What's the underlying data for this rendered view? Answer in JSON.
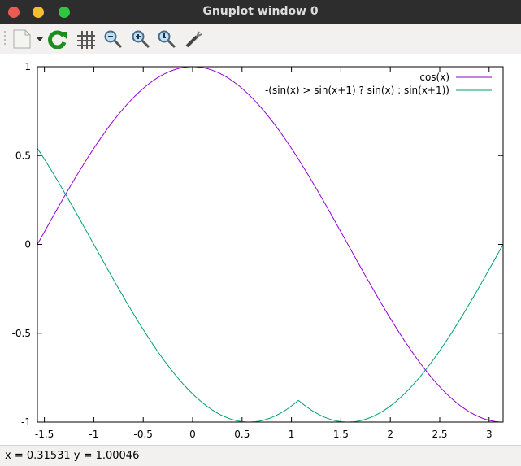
{
  "window": {
    "title": "Gnuplot window 0",
    "colors": {
      "close": "#ee5a52",
      "minimize": "#f5be2f",
      "maximize": "#2dc840"
    }
  },
  "toolbar": {
    "items": [
      "export-icon",
      "replot-icon",
      "grid-icon",
      "zoom-prev-icon",
      "zoom-next-icon",
      "unzoom-icon",
      "settings-icon"
    ]
  },
  "status": {
    "text": "x = 0.31531 y = 1.00046"
  },
  "chart_data": {
    "type": "line",
    "xlim": [
      -1.5708,
      3.1416
    ],
    "ylim": [
      -1,
      1
    ],
    "xticks": [
      "-1.5",
      "-1",
      "-0.5",
      "0",
      "0.5",
      "1",
      "1.5",
      "2",
      "2.5",
      "3"
    ],
    "xtick_values": [
      -1.5,
      -1,
      -0.5,
      0,
      0.5,
      1,
      1.5,
      2,
      2.5,
      3
    ],
    "yticks": [
      "1",
      "0.5",
      "0",
      "-0.5",
      "-1"
    ],
    "ytick_values": [
      1,
      0.5,
      0,
      -0.5,
      -1
    ],
    "legend_position": "top-right",
    "grid": false,
    "x": [
      -1.5,
      -1,
      -0.5,
      0,
      0.5,
      1,
      1.5,
      2,
      2.5,
      3
    ],
    "series": [
      {
        "name": "cos(x)",
        "color": "#9400d3",
        "values": [
          0.0707,
          0.5403,
          0.8776,
          1,
          0.8776,
          0.5403,
          0.0707,
          -0.4161,
          -0.8011,
          -0.99
        ]
      },
      {
        "name": "-(sin(x) > sin(x+1) ? sin(x) : sin(x+1))",
        "color": "#009e73",
        "values": [
          0.479,
          0,
          -0.479,
          -0.841,
          -0.997,
          -0.909,
          -0.997,
          -0.909,
          -0.598,
          -0.141
        ]
      }
    ]
  }
}
